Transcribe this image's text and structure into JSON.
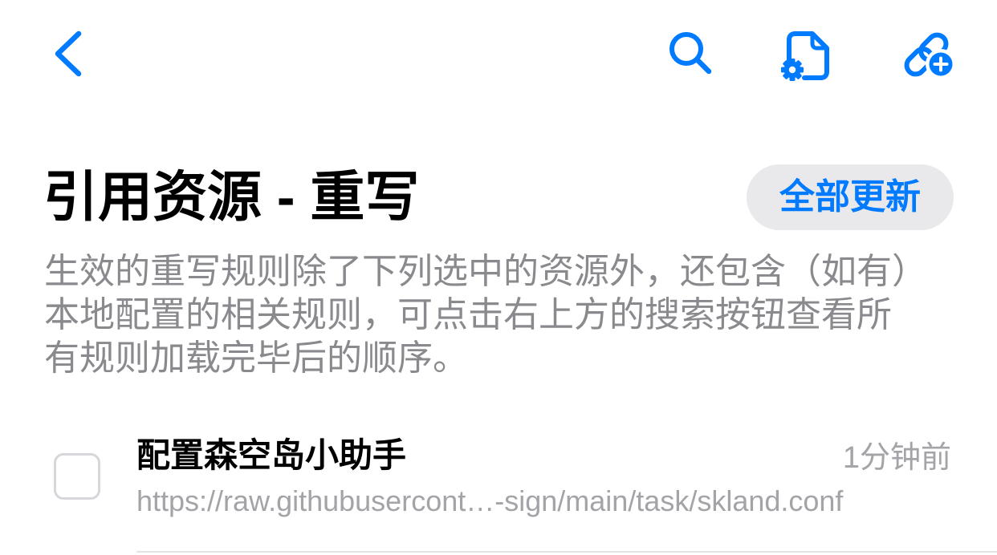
{
  "nav": {
    "back": {
      "icon": "chevron-left-icon"
    },
    "search": {
      "icon": "search-icon"
    },
    "rewrite_settings": {
      "icon": "document-gear-icon"
    },
    "add_resource": {
      "icon": "link-plus-icon"
    }
  },
  "header": {
    "title": "引用资源 - 重写",
    "update_all_button": "全部更新"
  },
  "description": {
    "lines": [
      "生效的重写规则除了下列选中的资源外，还包含（如有）",
      "本地配置的相关规则，可点击右上方的搜索按钮查看所",
      "有规则加载完毕后的顺序。"
    ]
  },
  "resources": [
    {
      "name": "配置森空岛小助手",
      "url": "https://raw.githubusercont…-sign/main/task/skland.conf",
      "updated": "1分钟前",
      "selected": false
    }
  ],
  "colors": {
    "accent": "#007AFF",
    "primary": "#000000",
    "secondary": "#8A8A8E",
    "tertiary": "#A3A3A8",
    "fill": "#E9E9EB",
    "separator": "#E3E3E8",
    "checkbox_border": "#D6D6DB"
  }
}
